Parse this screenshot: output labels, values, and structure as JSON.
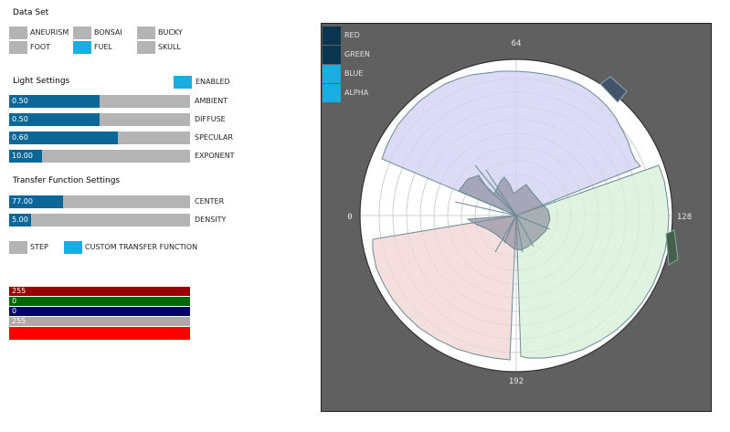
{
  "dataset": {
    "title": "Data Set",
    "items": [
      {
        "label": "ANEURISM",
        "active": false
      },
      {
        "label": "BONSAI",
        "active": false
      },
      {
        "label": "BUCKY",
        "active": false
      },
      {
        "label": "FOOT",
        "active": false
      },
      {
        "label": "FUEL",
        "active": true
      },
      {
        "label": "SKULL",
        "active": false
      }
    ]
  },
  "light": {
    "title": "Light Settings",
    "enabled_label": "ENABLED",
    "enabled": true,
    "sliders": [
      {
        "label": "AMBIENT",
        "value": "0.50",
        "fraction": 0.5
      },
      {
        "label": "DIFFUSE",
        "value": "0.50",
        "fraction": 0.5
      },
      {
        "label": "SPECULAR",
        "value": "0.60",
        "fraction": 0.6
      },
      {
        "label": "EXPONENT",
        "value": "10.00",
        "fraction": 0.18
      }
    ]
  },
  "transfer": {
    "title": "Transfer Function Settings",
    "sliders": [
      {
        "label": "CENTER",
        "value": "77.00",
        "fraction": 0.3
      },
      {
        "label": "DENSITY",
        "value": "5.00",
        "fraction": 0.12
      }
    ],
    "step_label": "STEP",
    "step_on": false,
    "custom_label": "CUSTOM TRANSFER FUNCTION",
    "custom_on": true
  },
  "color_values": {
    "red": "255",
    "green": "0",
    "blue": "0",
    "alpha": "255"
  },
  "colors": {
    "red_bar": "#990000",
    "green_bar": "#006600",
    "blue_bar": "#000066",
    "alpha_bar": "#aaaaaa",
    "preview": "#ff0000",
    "accent": "#1aaee0",
    "slider_fill": "#0a6797",
    "panel_bg": "#606060"
  },
  "legend": [
    {
      "label": "RED",
      "color": "#0a3550"
    },
    {
      "label": "GREEN",
      "color": "#0a3550"
    },
    {
      "label": "BLUE",
      "color": "#1aaee0"
    },
    {
      "label": "ALPHA",
      "color": "#1aaee0"
    }
  ],
  "polar": {
    "labels": {
      "top": "64",
      "right": "128",
      "bottom": "192",
      "left": "0"
    }
  }
}
